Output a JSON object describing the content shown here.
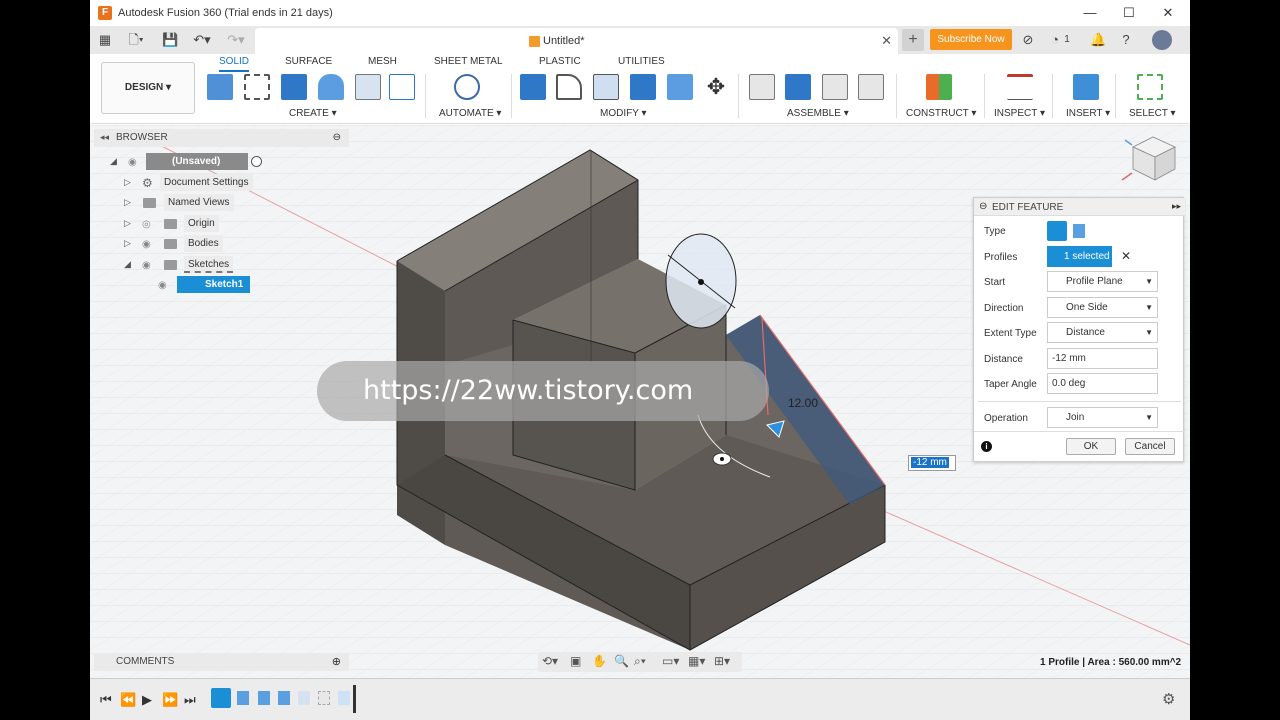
{
  "window": {
    "title": "Autodesk Fusion 360 (Trial ends in 21 days)",
    "minimize": "—",
    "maximize": "☐",
    "close": "✕"
  },
  "tabbar": {
    "doc_title": "Untitled*",
    "close": "✕",
    "new_tab": "+",
    "subscribe": "Subscribe Now",
    "jobs_count": "1"
  },
  "toolbar": {
    "workspace": "DESIGN ▾",
    "tabs": [
      "SOLID",
      "SURFACE",
      "MESH",
      "SHEET METAL",
      "PLASTIC",
      "UTILITIES"
    ],
    "groups": [
      "CREATE ▾",
      "AUTOMATE ▾",
      "MODIFY ▾",
      "ASSEMBLE ▾",
      "CONSTRUCT ▾",
      "INSPECT ▾",
      "INSERT ▾",
      "SELECT ▾"
    ]
  },
  "browser": {
    "title": "BROWSER",
    "items": [
      {
        "label": "(Unsaved)"
      },
      {
        "label": "Document Settings"
      },
      {
        "label": "Named Views"
      },
      {
        "label": "Origin"
      },
      {
        "label": "Bodies"
      },
      {
        "label": "Sketches"
      },
      {
        "label": "Sketch1"
      }
    ]
  },
  "comments": {
    "title": "COMMENTS"
  },
  "edit_feature": {
    "title": "EDIT FEATURE",
    "labels": {
      "type": "Type",
      "profiles": "Profiles",
      "start": "Start",
      "direction": "Direction",
      "extent_type": "Extent Type",
      "distance": "Distance",
      "taper_angle": "Taper Angle",
      "operation": "Operation"
    },
    "values": {
      "profiles": "1 selected",
      "start": "Profile Plane",
      "direction": "One Side",
      "extent_type": "Distance",
      "distance": "-12 mm",
      "taper_angle": "0.0 deg",
      "operation": "Join"
    },
    "ok": "OK",
    "cancel": "Cancel"
  },
  "viewport": {
    "dimension_label": "12.00",
    "distance_input": "-12 mm",
    "watermark": "https://22ww.tistory.com",
    "status": "1 Profile | Area : 560.00 mm^2"
  },
  "colors": {
    "accent": "#1473c4",
    "subscribe": "#f7941d",
    "selection": "#1a73c9"
  }
}
